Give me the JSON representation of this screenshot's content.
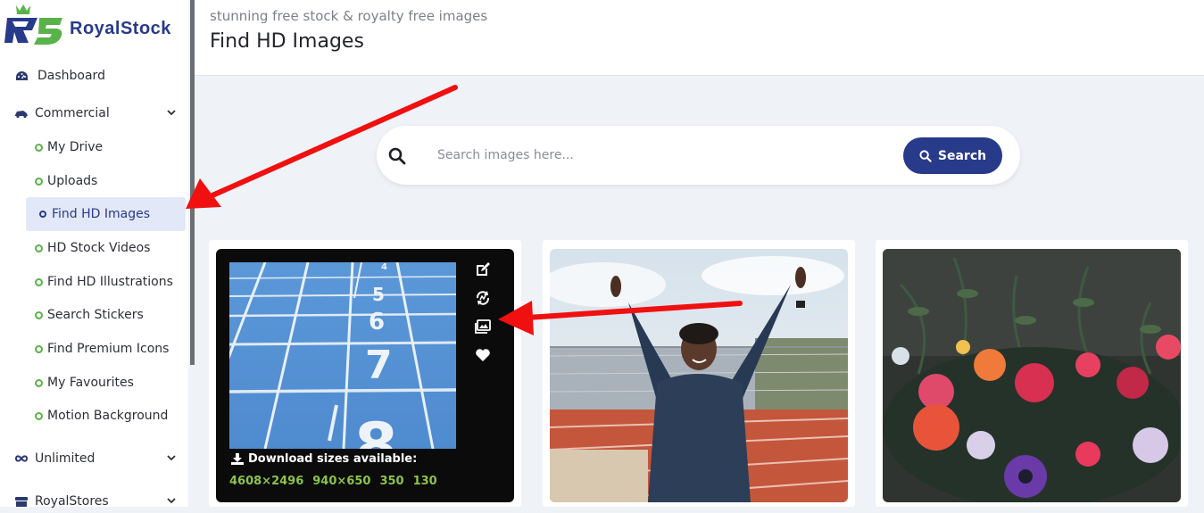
{
  "brand": {
    "logo_mark": "R5",
    "name": "RoyalStock"
  },
  "sidebar": {
    "dashboard": "Dashboard",
    "commercial": "Commercial",
    "items": [
      "My Drive",
      "Uploads",
      "Find HD Images",
      "HD Stock Videos",
      "Find HD Illustrations",
      "Search Stickers",
      "Find Premium Icons",
      "My Favourites",
      "Motion Background"
    ],
    "active_item": "Find HD Images",
    "unlimited": "Unlimited",
    "royalstores": "RoyalStores"
  },
  "header": {
    "subtitle": "stunning free stock & royalty free images",
    "title": "Find HD Images"
  },
  "search": {
    "placeholder": "Search images here...",
    "button_label": "Search"
  },
  "cards": [
    {
      "download_label": "Download sizes available:",
      "sizes": [
        "4608×2496",
        "940×650",
        "350",
        "130"
      ],
      "track_numbers": [
        "4",
        "5",
        "6",
        "7",
        "8"
      ],
      "actions": [
        "edit-icon",
        "ai-sync-icon",
        "image-gallery-icon",
        "heart-icon"
      ]
    },
    {
      "subject": "athlete-celebrating"
    },
    {
      "subject": "flower-bouquet"
    }
  ],
  "colors": {
    "brand_blue": "#283a8a",
    "brand_green": "#5ab24a",
    "size_green": "#8bc34a",
    "arrow_red": "#f01010",
    "background": "#eff2f7"
  }
}
